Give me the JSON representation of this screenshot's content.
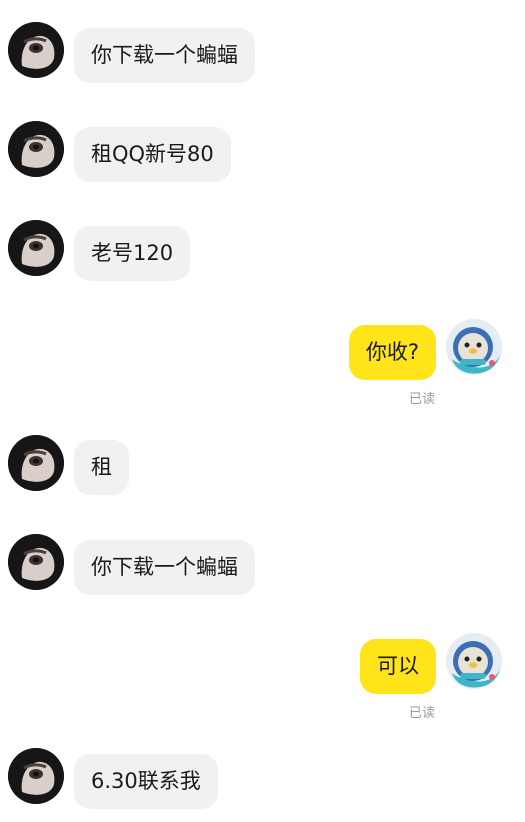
{
  "messages": [
    {
      "from": "other",
      "text": "你下载一个蝙蝠"
    },
    {
      "from": "other",
      "text": "租QQ新号80"
    },
    {
      "from": "other",
      "text": "老号120"
    },
    {
      "from": "me",
      "text": "你收?",
      "status": "已读"
    },
    {
      "from": "other",
      "text": "租"
    },
    {
      "from": "other",
      "text": "你下载一个蝙蝠"
    },
    {
      "from": "me",
      "text": "可以",
      "status": "已读"
    },
    {
      "from": "other",
      "text": "6.30联系我"
    }
  ],
  "colors": {
    "incoming_bubble": "#f1f1f3",
    "outgoing_bubble": "#ffe41a",
    "read_status": "#9a9a9a"
  },
  "icons": {
    "other_avatar": "dark-face-avatar-icon",
    "my_avatar": "cartoon-seal-avatar-icon"
  }
}
